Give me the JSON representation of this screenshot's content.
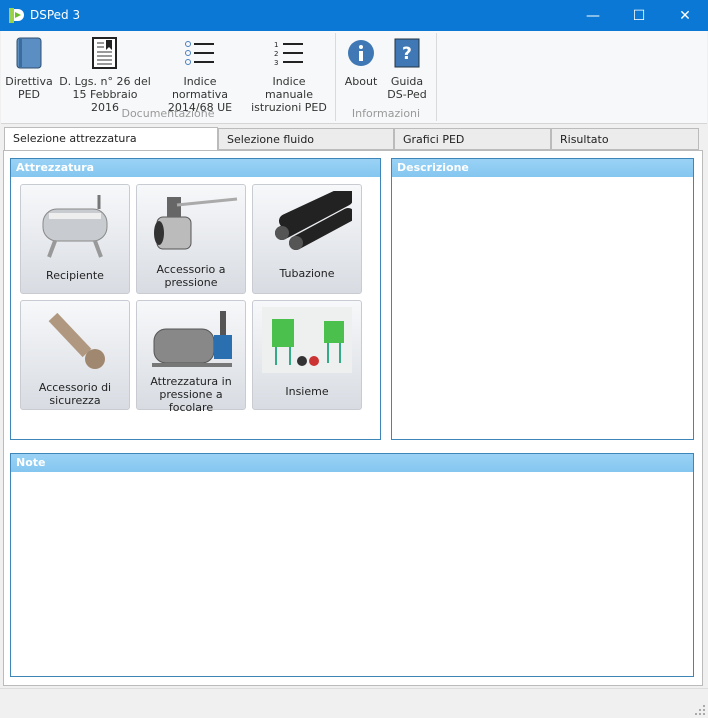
{
  "window": {
    "title": "DSPed 3",
    "minimize": "—",
    "maximize": "☐",
    "close": "✕"
  },
  "ribbon": {
    "groups": [
      {
        "label": "Documentazione",
        "items": [
          {
            "line1": "Direttiva",
            "line2": "PED",
            "icon": "book-icon"
          },
          {
            "line1": "D. Lgs. n° 26 del",
            "line2": "15 Febbraio 2016",
            "icon": "document-bookmark-icon"
          },
          {
            "line1": "Indice normativa",
            "line2": "2014/68 UE",
            "icon": "bullet-list-icon"
          },
          {
            "line1": "Indice manuale",
            "line2": "istruzioni PED",
            "icon": "numbered-list-icon"
          }
        ]
      },
      {
        "label": "Informazioni",
        "items": [
          {
            "line1": "About",
            "line2": "",
            "icon": "info-icon"
          },
          {
            "line1": "Guida",
            "line2": "DS-Ped",
            "icon": "help-book-icon"
          }
        ]
      }
    ]
  },
  "tabs": [
    {
      "label": "Selezione attrezzatura",
      "selected": true
    },
    {
      "label": "Selezione fluido",
      "selected": false
    },
    {
      "label": "Grafici PED",
      "selected": false
    },
    {
      "label": "Risultato",
      "selected": false
    }
  ],
  "panels": {
    "attrezzatura": {
      "title": "Attrezzatura",
      "items": [
        {
          "line1": "Recipiente",
          "line2": ""
        },
        {
          "line1": "Accessorio a",
          "line2": "pressione"
        },
        {
          "line1": "Tubazione",
          "line2": ""
        },
        {
          "line1": "Accessorio di",
          "line2": "sicurezza"
        },
        {
          "line1": "Attrezzatura in",
          "line2": "pressione a focolare"
        },
        {
          "line1": "Insieme",
          "line2": ""
        }
      ]
    },
    "descrizione": {
      "title": "Descrizione"
    },
    "note": {
      "title": "Note"
    }
  },
  "colors": {
    "titlebar": "#0a78d4",
    "panel_header": "#8ccbf2",
    "panel_border": "#3f86b8"
  }
}
